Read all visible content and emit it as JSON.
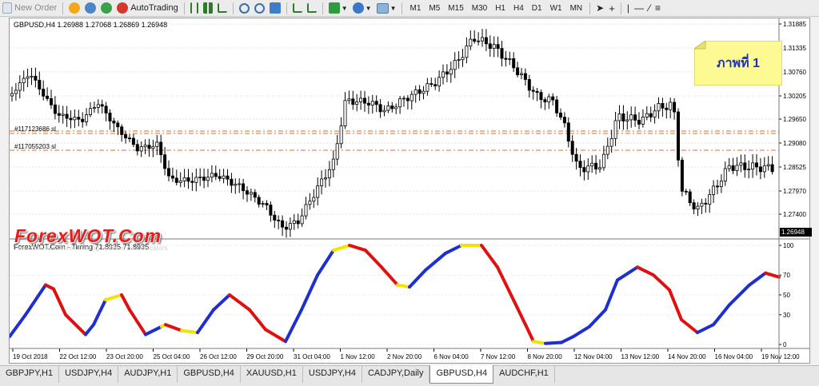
{
  "toolbar": {
    "new_order": "New Order",
    "auto_trading": "AutoTrading",
    "timeframes": [
      "M1",
      "M5",
      "M15",
      "M30",
      "H1",
      "H4",
      "D1",
      "W1",
      "MN"
    ]
  },
  "chart": {
    "header": "GBPUSD,H4  1.26988 1.27068 1.26869 1.26948",
    "price_labels": [
      "1.31885",
      "1.31335",
      "1.30760",
      "1.30205",
      "1.29650",
      "1.29080",
      "1.28525",
      "1.27970",
      "1.27400"
    ],
    "current_price": "1.26948",
    "orders": [
      "#117123686 sl",
      "#117055203 sl"
    ],
    "colors": {
      "bull": "#000000",
      "bear": "#000000",
      "order_line": "#e06a2c",
      "osc_up": "#1e2fd0",
      "osc_down": "#e01010",
      "osc_turn": "#f2e400"
    }
  },
  "indicator": {
    "header": "ForexWOT.Com - Timing 71.8935 71.8935",
    "levels": [
      "100",
      "70",
      "50",
      "30",
      "0"
    ]
  },
  "time_axis": [
    "19 Oct 2018",
    "22 Oct 12:00",
    "23 Oct 20:00",
    "25 Oct 04:00",
    "26 Oct 12:00",
    "29 Oct 20:00",
    "31 Oct 04:00",
    "1 Nov 12:00",
    "2 Nov 20:00",
    "6 Nov 04:00",
    "7 Nov 12:00",
    "8 Nov 20:00",
    "12 Nov 04:00",
    "13 Nov 12:00",
    "14 Nov 20:00",
    "16 Nov 04:00",
    "19 Nov 12:00"
  ],
  "callout": {
    "text": "ภาพที่ 1"
  },
  "watermark": {
    "title": "ForexWOT.Com",
    "subtitle": "Free Download Forex Trading Systems and Indicators"
  },
  "tabs": [
    "GBPJPY,H1",
    "USDJPY,H4",
    "AUDJPY,H1",
    "GBPUSD,H4",
    "XAUUSD,H1",
    "USDJPY,H4",
    "CADJPY,Daily",
    "GBPUSD,H4",
    "AUDCHF,H1"
  ],
  "active_tab_index": 7
}
